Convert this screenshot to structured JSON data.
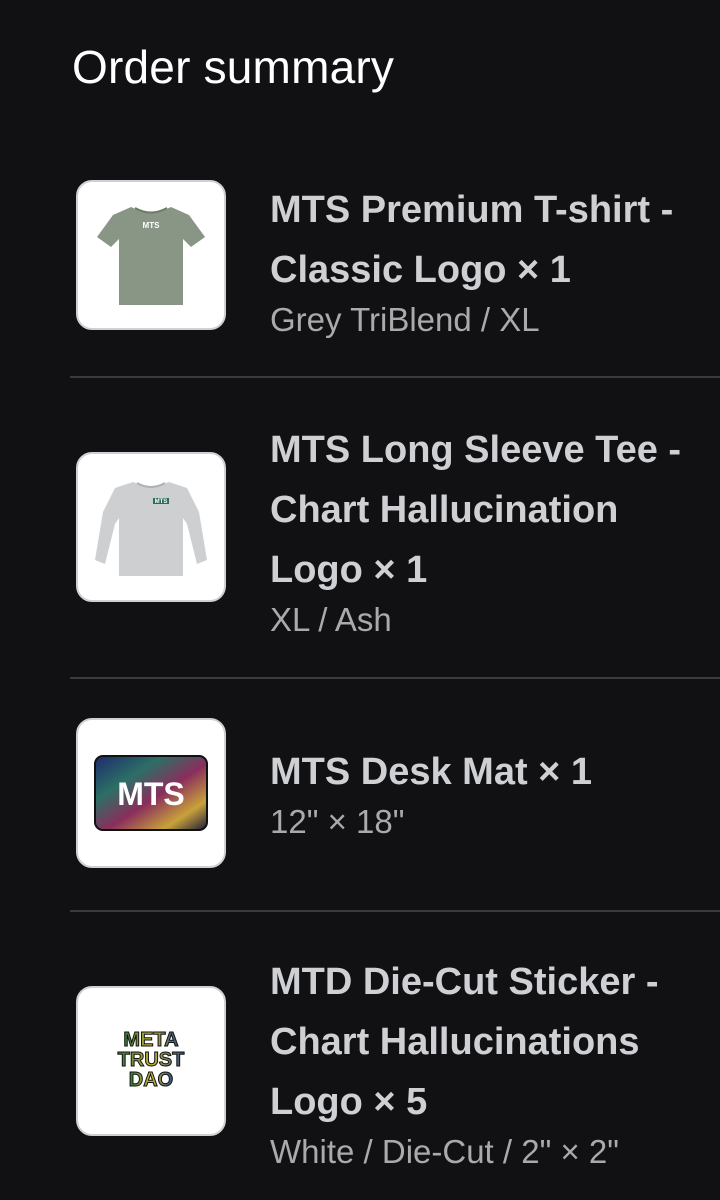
{
  "header": {
    "title": "Order summary"
  },
  "items": [
    {
      "title": "MTS Premium T-shirt - Classic Logo × 1",
      "variant": "Grey TriBlend / XL",
      "image": {
        "kind": "tshirt",
        "icon": "tshirt-image",
        "logo_text": "MTS",
        "color": "#8a9685"
      }
    },
    {
      "title": "MTS Long Sleeve Tee - Chart Hallucination Logo × 1",
      "variant": "XL / Ash",
      "image": {
        "kind": "longsleeve",
        "icon": "long-sleeve-image",
        "logo_text": "MTS",
        "color": "#cdcfd1"
      }
    },
    {
      "title": "MTS Desk Mat × 1",
      "variant": "12\" × 18\"",
      "image": {
        "kind": "deskmat",
        "icon": "desk-mat-image",
        "logo_text": "MTS"
      }
    },
    {
      "title": "MTD Die-Cut Sticker - Chart Hallucinations Logo × 5",
      "variant": "White / Die-Cut / 2\" × 2\"",
      "image": {
        "kind": "sticker",
        "icon": "sticker-image",
        "logo_lines": [
          "META",
          "TRUST",
          "DAO"
        ]
      }
    }
  ]
}
